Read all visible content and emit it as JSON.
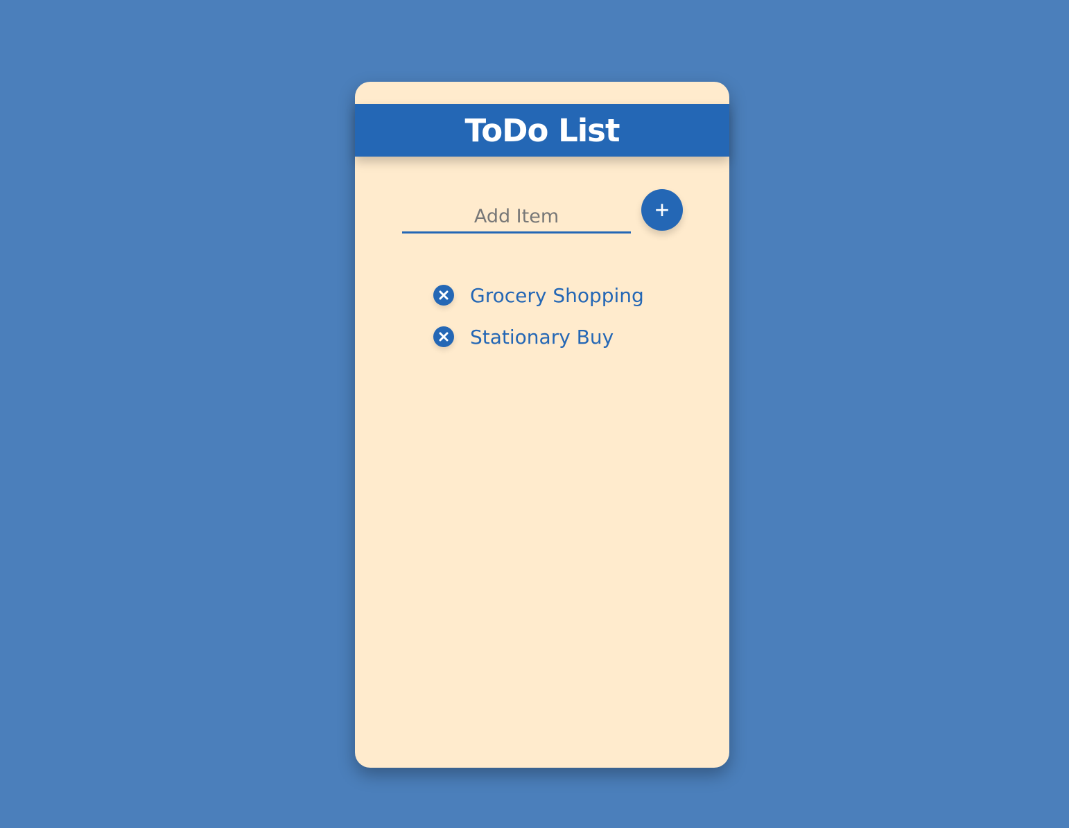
{
  "header": {
    "title": "ToDo List"
  },
  "input": {
    "placeholder": "Add Item",
    "value": ""
  },
  "add_button": {
    "label": "+"
  },
  "items": [
    {
      "text": "Grocery Shopping",
      "icon": "close-circle-icon"
    },
    {
      "text": "Stationary Buy",
      "icon": "close-circle-icon"
    }
  ],
  "colors": {
    "background": "#4b7fbb",
    "card": "#ffebcd",
    "accent": "#2467b5"
  }
}
